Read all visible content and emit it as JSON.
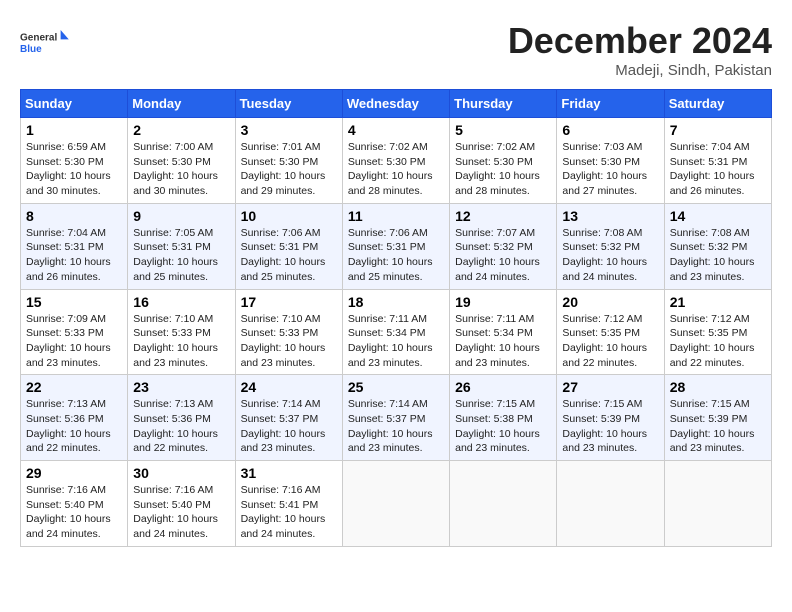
{
  "header": {
    "logo_general": "General",
    "logo_blue": "Blue",
    "month_year": "December 2024",
    "location": "Madeji, Sindh, Pakistan"
  },
  "days_of_week": [
    "Sunday",
    "Monday",
    "Tuesday",
    "Wednesday",
    "Thursday",
    "Friday",
    "Saturday"
  ],
  "weeks": [
    [
      {
        "day": 1,
        "sunrise": "6:59 AM",
        "sunset": "5:30 PM",
        "daylight": "10 hours and 30 minutes."
      },
      {
        "day": 2,
        "sunrise": "7:00 AM",
        "sunset": "5:30 PM",
        "daylight": "10 hours and 30 minutes."
      },
      {
        "day": 3,
        "sunrise": "7:01 AM",
        "sunset": "5:30 PM",
        "daylight": "10 hours and 29 minutes."
      },
      {
        "day": 4,
        "sunrise": "7:02 AM",
        "sunset": "5:30 PM",
        "daylight": "10 hours and 28 minutes."
      },
      {
        "day": 5,
        "sunrise": "7:02 AM",
        "sunset": "5:30 PM",
        "daylight": "10 hours and 28 minutes."
      },
      {
        "day": 6,
        "sunrise": "7:03 AM",
        "sunset": "5:30 PM",
        "daylight": "10 hours and 27 minutes."
      },
      {
        "day": 7,
        "sunrise": "7:04 AM",
        "sunset": "5:31 PM",
        "daylight": "10 hours and 26 minutes."
      }
    ],
    [
      {
        "day": 8,
        "sunrise": "7:04 AM",
        "sunset": "5:31 PM",
        "daylight": "10 hours and 26 minutes."
      },
      {
        "day": 9,
        "sunrise": "7:05 AM",
        "sunset": "5:31 PM",
        "daylight": "10 hours and 25 minutes."
      },
      {
        "day": 10,
        "sunrise": "7:06 AM",
        "sunset": "5:31 PM",
        "daylight": "10 hours and 25 minutes."
      },
      {
        "day": 11,
        "sunrise": "7:06 AM",
        "sunset": "5:31 PM",
        "daylight": "10 hours and 25 minutes."
      },
      {
        "day": 12,
        "sunrise": "7:07 AM",
        "sunset": "5:32 PM",
        "daylight": "10 hours and 24 minutes."
      },
      {
        "day": 13,
        "sunrise": "7:08 AM",
        "sunset": "5:32 PM",
        "daylight": "10 hours and 24 minutes."
      },
      {
        "day": 14,
        "sunrise": "7:08 AM",
        "sunset": "5:32 PM",
        "daylight": "10 hours and 23 minutes."
      }
    ],
    [
      {
        "day": 15,
        "sunrise": "7:09 AM",
        "sunset": "5:33 PM",
        "daylight": "10 hours and 23 minutes."
      },
      {
        "day": 16,
        "sunrise": "7:10 AM",
        "sunset": "5:33 PM",
        "daylight": "10 hours and 23 minutes."
      },
      {
        "day": 17,
        "sunrise": "7:10 AM",
        "sunset": "5:33 PM",
        "daylight": "10 hours and 23 minutes."
      },
      {
        "day": 18,
        "sunrise": "7:11 AM",
        "sunset": "5:34 PM",
        "daylight": "10 hours and 23 minutes."
      },
      {
        "day": 19,
        "sunrise": "7:11 AM",
        "sunset": "5:34 PM",
        "daylight": "10 hours and 23 minutes."
      },
      {
        "day": 20,
        "sunrise": "7:12 AM",
        "sunset": "5:35 PM",
        "daylight": "10 hours and 22 minutes."
      },
      {
        "day": 21,
        "sunrise": "7:12 AM",
        "sunset": "5:35 PM",
        "daylight": "10 hours and 22 minutes."
      }
    ],
    [
      {
        "day": 22,
        "sunrise": "7:13 AM",
        "sunset": "5:36 PM",
        "daylight": "10 hours and 22 minutes."
      },
      {
        "day": 23,
        "sunrise": "7:13 AM",
        "sunset": "5:36 PM",
        "daylight": "10 hours and 22 minutes."
      },
      {
        "day": 24,
        "sunrise": "7:14 AM",
        "sunset": "5:37 PM",
        "daylight": "10 hours and 23 minutes."
      },
      {
        "day": 25,
        "sunrise": "7:14 AM",
        "sunset": "5:37 PM",
        "daylight": "10 hours and 23 minutes."
      },
      {
        "day": 26,
        "sunrise": "7:15 AM",
        "sunset": "5:38 PM",
        "daylight": "10 hours and 23 minutes."
      },
      {
        "day": 27,
        "sunrise": "7:15 AM",
        "sunset": "5:39 PM",
        "daylight": "10 hours and 23 minutes."
      },
      {
        "day": 28,
        "sunrise": "7:15 AM",
        "sunset": "5:39 PM",
        "daylight": "10 hours and 23 minutes."
      }
    ],
    [
      {
        "day": 29,
        "sunrise": "7:16 AM",
        "sunset": "5:40 PM",
        "daylight": "10 hours and 24 minutes."
      },
      {
        "day": 30,
        "sunrise": "7:16 AM",
        "sunset": "5:40 PM",
        "daylight": "10 hours and 24 minutes."
      },
      {
        "day": 31,
        "sunrise": "7:16 AM",
        "sunset": "5:41 PM",
        "daylight": "10 hours and 24 minutes."
      },
      null,
      null,
      null,
      null
    ]
  ]
}
